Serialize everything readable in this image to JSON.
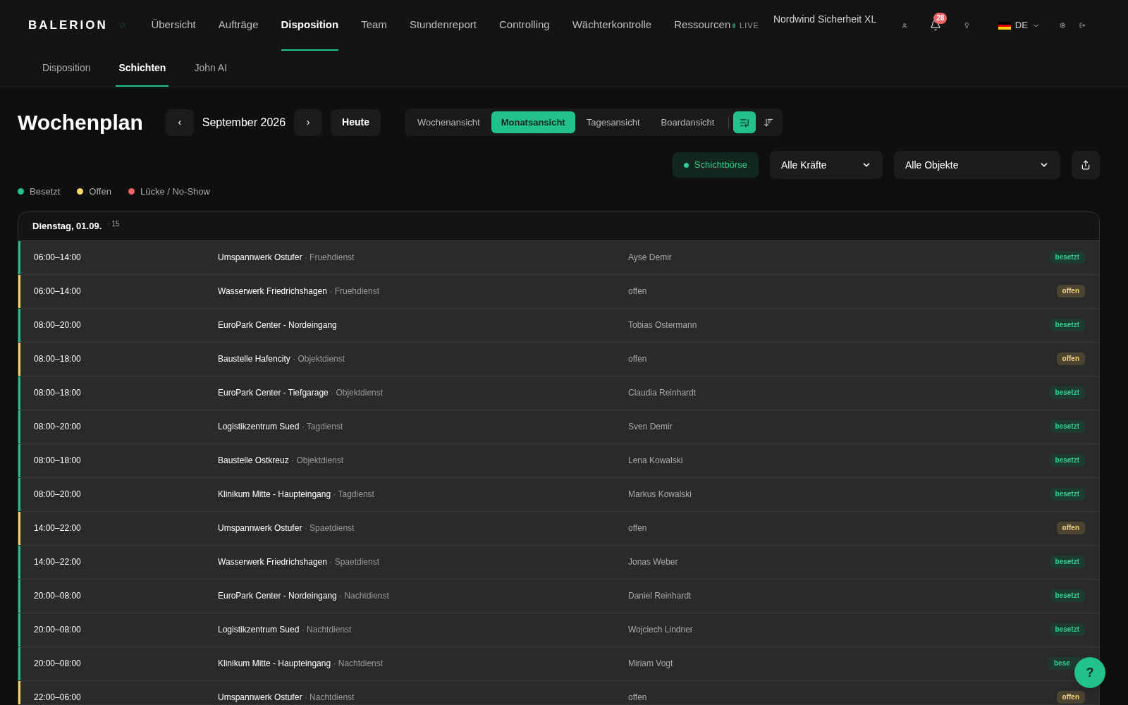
{
  "brand": {
    "name": "BALERION"
  },
  "nav": [
    {
      "label": "Übersicht",
      "selected": false
    },
    {
      "label": "Aufträge",
      "selected": false
    },
    {
      "label": "Disposition",
      "selected": true
    },
    {
      "label": "Team",
      "selected": false
    },
    {
      "label": "Stundenreport",
      "selected": false
    },
    {
      "label": "Controlling",
      "selected": false
    },
    {
      "label": "Wächterkontrolle",
      "selected": false
    },
    {
      "label": "Ressourcen",
      "selected": false
    }
  ],
  "live": {
    "label": "LIVE"
  },
  "company": "Nordwind Sicherheit XL",
  "notifications": {
    "count": "28"
  },
  "language": {
    "label": "DE"
  },
  "subnav": [
    {
      "label": "Disposition",
      "selected": false
    },
    {
      "label": "Schichten",
      "selected": true
    },
    {
      "label": "John AI",
      "selected": false
    }
  ],
  "page_title": "Wochenplan",
  "period": {
    "prev": "‹",
    "label": "September 2026",
    "next": "›",
    "today": "Heute"
  },
  "views": [
    {
      "label": "Wochenansicht",
      "selected": false
    },
    {
      "label": "Monatsansicht",
      "selected": true
    },
    {
      "label": "Tagesansicht",
      "selected": false
    },
    {
      "label": "Boardansicht",
      "selected": false
    }
  ],
  "sort_modes": [
    {
      "selected": true
    },
    {
      "selected": false
    }
  ],
  "shift_exchange": {
    "label": "Schichtbörse"
  },
  "filters": [
    {
      "value": "Alle Kräfte"
    },
    {
      "value": "Alle Objekte"
    }
  ],
  "legend": [
    {
      "label": "Besetzt",
      "color": "#22c08a"
    },
    {
      "label": "Offen",
      "color": "#f5d96b"
    },
    {
      "label": "Lücke / No-Show",
      "color": "#f06464"
    }
  ],
  "day": {
    "title": "Dienstag, 01.09.",
    "count": "· 15"
  },
  "rows": [
    {
      "time": "06:00–14:00",
      "site": "Umspannwerk Ostufer",
      "shift": "· Fruehdienst",
      "person": "Ayse Demir",
      "kind": "filled",
      "badge": "besetzt"
    },
    {
      "time": "06:00–14:00",
      "site": "Wasserwerk Friedrichshagen",
      "shift": "· Fruehdienst",
      "person": "offen",
      "kind": "open",
      "badge": "offen"
    },
    {
      "time": "08:00–20:00",
      "site": "EuroPark Center - Nordeingang",
      "person": "Tobias Ostermann",
      "kind": "filled",
      "badge": "besetzt"
    },
    {
      "time": "08:00–18:00",
      "site": "Baustelle Hafencity",
      "shift": "· Objektdienst",
      "person": "offen",
      "kind": "open",
      "badge": "offen"
    },
    {
      "time": "08:00–18:00",
      "site": "EuroPark Center - Tiefgarage",
      "shift": "· Objektdienst",
      "person": "Claudia Reinhardt",
      "kind": "filled",
      "badge": "besetzt"
    },
    {
      "time": "08:00–20:00",
      "site": "Logistikzentrum Sued",
      "shift": "· Tagdienst",
      "person": "Sven Demir",
      "kind": "filled",
      "badge": "besetzt"
    },
    {
      "time": "08:00–18:00",
      "site": "Baustelle Ostkreuz",
      "shift": "· Objektdienst",
      "person": "Lena Kowalski",
      "kind": "filled",
      "badge": "besetzt"
    },
    {
      "time": "08:00–20:00",
      "site": "Klinikum Mitte - Haupteingang",
      "shift": "· Tagdienst",
      "person": "Markus Kowalski",
      "kind": "filled",
      "badge": "besetzt"
    },
    {
      "time": "14:00–22:00",
      "site": "Umspannwerk Ostufer",
      "shift": "· Spaetdienst",
      "person": "offen",
      "kind": "open",
      "badge": "offen"
    },
    {
      "time": "14:00–22:00",
      "site": "Wasserwerk Friedrichshagen",
      "shift": "· Spaetdienst",
      "person": "Jonas Weber",
      "kind": "filled",
      "badge": "besetzt"
    },
    {
      "time": "20:00–08:00",
      "site": "EuroPark Center - Nordeingang",
      "shift": "· Nachtdienst",
      "person": "Daniel Reinhardt",
      "kind": "filled",
      "badge": "besetzt"
    },
    {
      "time": "20:00–08:00",
      "site": "Logistikzentrum Sued",
      "shift": "· Nachtdienst",
      "person": "Wojciech Lindner",
      "kind": "filled",
      "badge": "besetzt"
    },
    {
      "time": "20:00–08:00",
      "site": "Klinikum Mitte - Haupteingang",
      "shift": "· Nachtdienst",
      "person": "Miriam Vogt",
      "kind": "filled",
      "badge": "bese"
    },
    {
      "time": "22:00–06:00",
      "site": "Umspannwerk Ostufer",
      "shift": "· Nachtdienst",
      "person": "offen",
      "kind": "open",
      "badge": "offen"
    }
  ],
  "help": {
    "label": "?"
  }
}
